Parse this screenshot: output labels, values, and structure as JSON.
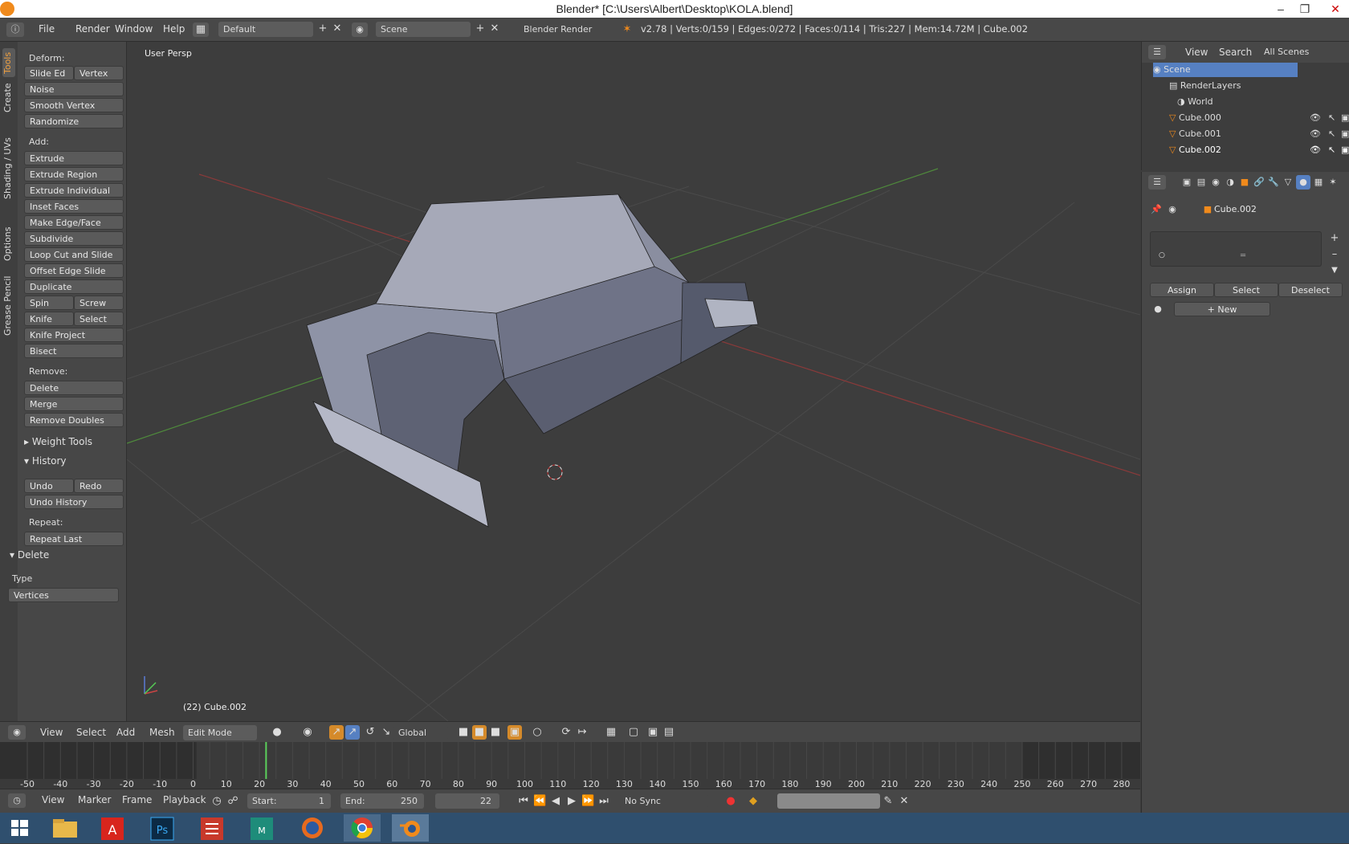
{
  "window": {
    "title": "Blender* [C:\\Users\\Albert\\Desktop\\KOLA.blend]"
  },
  "menubar": {
    "items": [
      "File",
      "Render",
      "Window",
      "Help"
    ],
    "layout": "Default",
    "scene": "Scene",
    "engine": "Blender Render",
    "stats": "v2.78 | Verts:0/159 | Edges:0/272 | Faces:0/114 | Tris:227 | Mem:14.72M | Cube.002"
  },
  "tabs": [
    "Tools",
    "Create",
    "Shading / UVs",
    "Options",
    "Grease Pencil"
  ],
  "tools": {
    "deform_label": "Deform:",
    "deform": [
      [
        "Slide Ed",
        "Vertex"
      ],
      [
        "Noise"
      ],
      [
        "Smooth Vertex"
      ],
      [
        "Randomize"
      ]
    ],
    "add_label": "Add:",
    "add": [
      [
        "Extrude"
      ],
      [
        "Extrude Region"
      ],
      [
        "Extrude Individual"
      ],
      [
        "Inset Faces"
      ],
      [
        "Make Edge/Face"
      ],
      [
        "Subdivide"
      ],
      [
        "Loop Cut and Slide"
      ],
      [
        "Offset Edge Slide"
      ],
      [
        "Duplicate"
      ],
      [
        "Spin",
        "Screw"
      ],
      [
        "Knife",
        "Select"
      ],
      [
        "Knife Project"
      ],
      [
        "Bisect"
      ]
    ],
    "remove_label": "Remove:",
    "remove": [
      [
        "Delete"
      ],
      [
        "Merge"
      ],
      [
        "Remove Doubles"
      ]
    ],
    "weight_tools": "Weight Tools",
    "history": "History",
    "history_btns": [
      [
        "Undo",
        "Redo"
      ],
      [
        "Undo History"
      ]
    ],
    "repeat_label": "Repeat:",
    "repeat": [
      [
        "Repeat Last"
      ]
    ]
  },
  "delete_panel": {
    "title": "Delete",
    "type_label": "Type",
    "type_value": "Vertices"
  },
  "viewport": {
    "label": "User Persp",
    "object_info": "(22) Cube.002"
  },
  "viewport_header": {
    "menus": [
      "View",
      "Select",
      "Add",
      "Mesh"
    ],
    "mode": "Edit Mode",
    "orientation": "Global"
  },
  "timeline": {
    "ticks": [
      "-50",
      "-40",
      "-30",
      "-20",
      "-10",
      "0",
      "10",
      "20",
      "30",
      "40",
      "50",
      "60",
      "70",
      "80",
      "90",
      "100",
      "110",
      "120",
      "130",
      "140",
      "150",
      "160",
      "170",
      "180",
      "190",
      "200",
      "210",
      "220",
      "230",
      "240",
      "250",
      "260",
      "270",
      "280"
    ],
    "current_frame": 22,
    "range_start": 1,
    "range_end": 250
  },
  "timeline_bar": {
    "menus": [
      "View",
      "Marker",
      "Frame",
      "Playback"
    ],
    "start_label": "Start:",
    "start": "1",
    "end_label": "End:",
    "end": "250",
    "frame": "22",
    "sync": "No Sync"
  },
  "outliner": {
    "menus": [
      "View",
      "Search",
      "All Scenes"
    ],
    "items": [
      "Scene",
      "RenderLayers",
      "World",
      "Cube.000",
      "Cube.001",
      "Cube.002"
    ]
  },
  "properties": {
    "object": "Cube.002",
    "buttons": [
      "Assign",
      "Select",
      "Deselect"
    ],
    "new_label": "New"
  },
  "colors": {
    "accent": "#f08a1c",
    "selected_blue": "#5680c2"
  }
}
